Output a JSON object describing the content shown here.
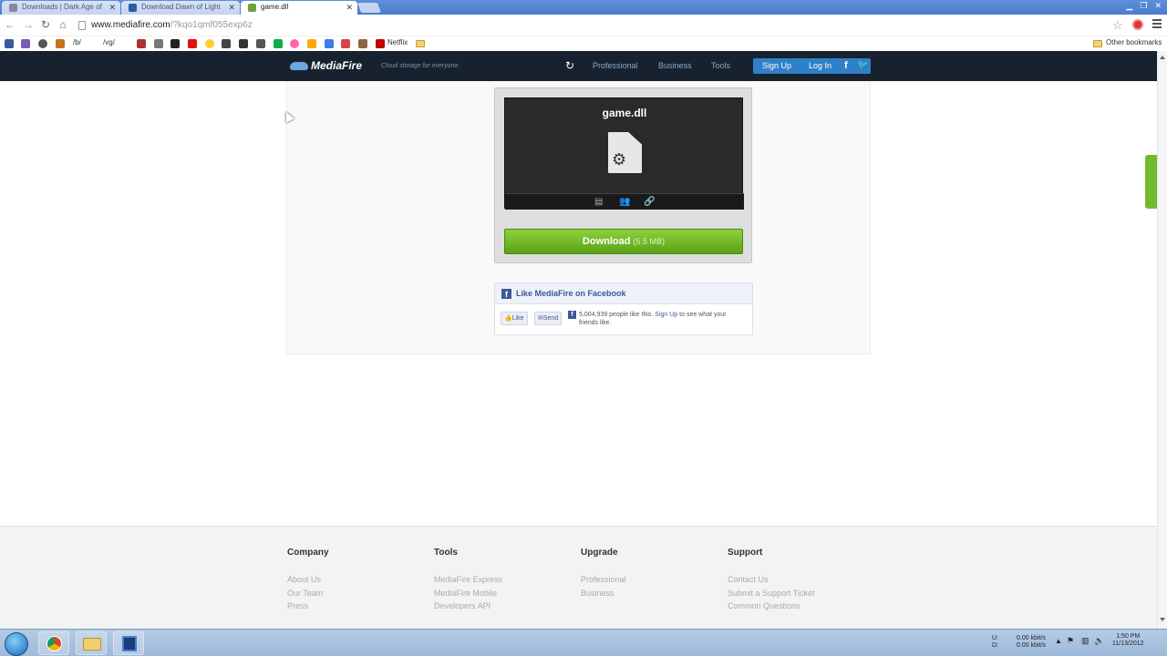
{
  "browser": {
    "tabs": [
      {
        "title": "Downloads | Dark Age of",
        "active": false
      },
      {
        "title": "Download Dawn of Light",
        "active": false
      },
      {
        "title": "game.dll",
        "active": true
      }
    ],
    "url_host": "www.mediafire.com",
    "url_path": "/?kqo1qmf055exp6z",
    "bookmarks_bar": {
      "netflix_label": "Netflix",
      "other_label": "Other bookmarks",
      "items": [
        "/b/",
        "/vg/"
      ]
    }
  },
  "site": {
    "logo_text": "MediaFire",
    "tagline": "Cloud storage for everyone.",
    "nav": [
      "Professional",
      "Business",
      "Tools"
    ],
    "signup_label": "Sign Up",
    "login_label": "Log In",
    "facebook_glyph": "f"
  },
  "file": {
    "name": "game.dll",
    "download_label": "Download",
    "size": "(5.5 MB)"
  },
  "facebook": {
    "title": "Like MediaFire on Facebook",
    "like_label": "Like",
    "send_label": "Send",
    "count_text": "5,004,939 people like this.",
    "signup_link": "Sign Up",
    "signup_tail": "to see what your friends like."
  },
  "footer": {
    "columns": [
      {
        "heading": "Company",
        "links": [
          "About Us",
          "Our Team",
          "Press"
        ]
      },
      {
        "heading": "Tools",
        "links": [
          "MediaFire Express",
          "MediaFire Mobile",
          "Developers API"
        ]
      },
      {
        "heading": "Upgrade",
        "links": [
          "Professional",
          "Business"
        ]
      },
      {
        "heading": "Support",
        "links": [
          "Contact Us",
          "Submit a Support Ticket",
          "Common Questions"
        ]
      }
    ]
  },
  "taskbar": {
    "net_up": "0.00 kbit/s",
    "net_down": "0.00 kbit/s",
    "time": "1:50 PM",
    "date": "11/13/2012"
  },
  "colors": {
    "header_bg": "#17222e",
    "download_green": "#5aa118",
    "auth_blue": "#2f80c8",
    "facebook_blue": "#3b5998"
  }
}
